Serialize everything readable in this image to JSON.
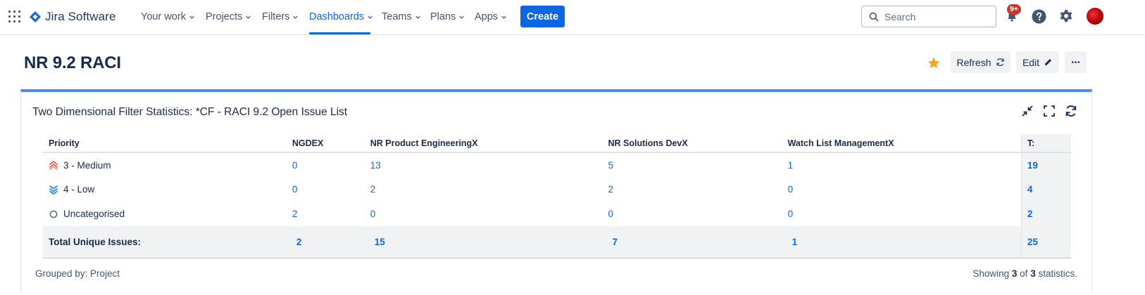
{
  "nav": {
    "brand": "Jira Software",
    "items": [
      {
        "label": "Your work"
      },
      {
        "label": "Projects"
      },
      {
        "label": "Filters"
      },
      {
        "label": "Dashboards"
      },
      {
        "label": "Teams"
      },
      {
        "label": "Plans"
      },
      {
        "label": "Apps"
      }
    ],
    "active_item": "Dashboards",
    "create_label": "Create",
    "search_placeholder": "Search",
    "notification_count": "9+",
    "accent_color": "#0c66e4"
  },
  "page": {
    "title": "NR 9.2 RACI",
    "starred": true,
    "refresh_label": "Refresh",
    "edit_label": "Edit"
  },
  "gadget": {
    "title": "Two Dimensional Filter Statistics: *CF - RACI 9.2 Open Issue List",
    "columns": [
      "Priority",
      "NGDEX",
      "NR Product EngineeringX",
      "NR Solutions DevX",
      "Watch List ManagementX",
      "T:"
    ],
    "rows": [
      {
        "priority": "3 - Medium",
        "icon": "medium-priority-icon",
        "values": [
          "0",
          "13",
          "5",
          "1"
        ],
        "total": "19"
      },
      {
        "priority": "4 - Low",
        "icon": "low-priority-icon",
        "values": [
          "0",
          "2",
          "2",
          "0"
        ],
        "total": "4"
      },
      {
        "priority": "Uncategorised",
        "icon": "uncategorised-icon",
        "values": [
          "2",
          "0",
          "0",
          "0"
        ],
        "total": "2"
      }
    ],
    "totals": {
      "label": "Total Unique Issues:",
      "values": [
        "2",
        "15",
        "7",
        "1"
      ],
      "total": "25"
    },
    "grouped_by_label": "Grouped by: Project",
    "showing": {
      "prefix": "Showing",
      "shown": "3",
      "of_word": "of",
      "total": "3",
      "suffix": "statistics."
    }
  }
}
